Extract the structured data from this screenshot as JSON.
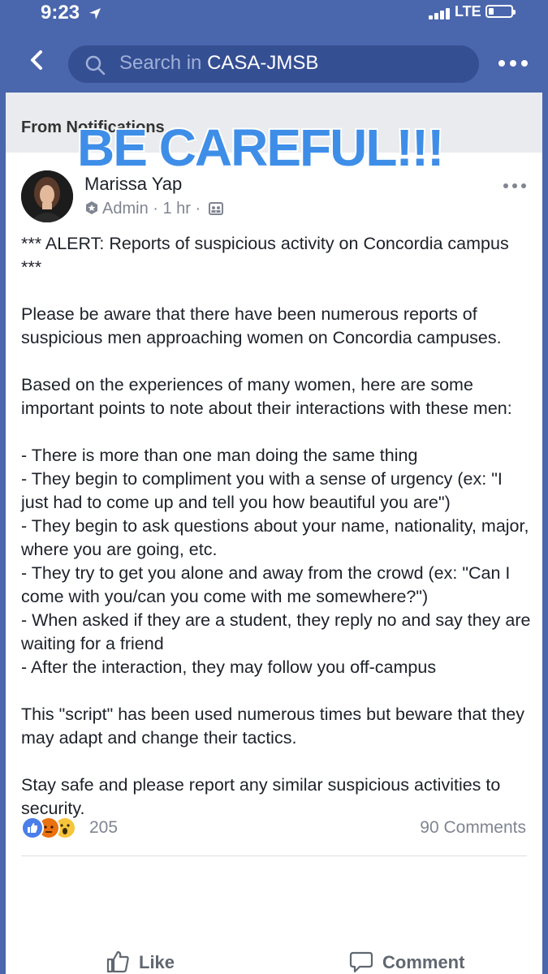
{
  "status_bar": {
    "time": "9:23",
    "network": "LTE",
    "icons": [
      "location-arrow-icon",
      "signal-icon",
      "battery-icon"
    ]
  },
  "nav": {
    "back_icon": "chevron-left-icon",
    "search_placeholder": "Search in",
    "search_group": "CASA-JMSB",
    "more_icon": "more-horizontal-icon"
  },
  "notification": {
    "label": "From Notifications",
    "sticker": "BE CAREFUL!!!"
  },
  "post": {
    "author": "Marissa Yap",
    "role": "Admin",
    "time": "1 hr",
    "paragraphs": [
      "*** ALERT: Reports of suspicious activity on Concordia campus ***",
      "Please be aware that there have been numerous reports of suspicious men approaching women on Concordia campuses.",
      "Based on the experiences of many women, here are some important points to note about their interactions with these men:",
      "- There is more than one man doing the same thing\n- They begin to compliment you with a sense of urgency (ex: \"I just had to come up and tell you how beautiful you are\")\n- They begin to ask questions about your name, nationality, major, where you are going, etc.\n- They try to get you alone and away from the crowd (ex: \"Can I come with you/can you come with me somewhere?\")\n- When asked if they are a student, they reply no and say they are waiting for a friend\n- After the interaction, they may follow you off-campus",
      "This \"script\" has been used numerous times but beware that they may adapt and change their tactics.",
      "Stay safe and please report any similar suspicious activities to security."
    ],
    "reaction_count": "205",
    "comment_count": "90 Comments",
    "reactions": [
      "like",
      "angry",
      "wow"
    ],
    "actions": {
      "like": "Like",
      "comment": "Comment"
    }
  },
  "colors": {
    "facebook_blue": "#4a66ad",
    "search_bg": "#354f93",
    "sticker": "#3e8ee8"
  }
}
